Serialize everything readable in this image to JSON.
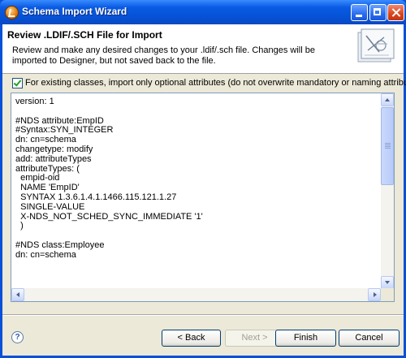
{
  "window": {
    "title": "Schema Import Wizard"
  },
  "header": {
    "title": "Review .LDIF/.SCH File for Import",
    "description": "Review and make any desired changes to your .ldif/.sch file.  Changes will be imported to Designer, but not saved back to the file."
  },
  "options": {
    "optional_attributes_checked": true,
    "optional_attributes_label": "For existing classes, import only optional attributes (do not overwrite mandatory or naming attributes)"
  },
  "content": {
    "lines": [
      "version: 1",
      "",
      "#NDS attribute:EmpID",
      "#Syntax:SYN_INTEGER",
      "dn: cn=schema",
      "changetype: modify",
      "add: attributeTypes",
      "attributeTypes: (",
      "  empid-oid",
      "  NAME 'EmpID'",
      "  SYNTAX 1.3.6.1.4.1.1466.115.121.1.27",
      "  SINGLE-VALUE",
      "  X-NDS_NOT_SCHED_SYNC_IMMEDIATE '1'",
      "  )",
      "",
      "#NDS class:Employee",
      "dn: cn=schema"
    ]
  },
  "buttons": {
    "back": "< Back",
    "next": "Next >",
    "finish": "Finish",
    "cancel": "Cancel"
  },
  "help": {
    "glyph": "?"
  },
  "icons": {
    "app": "eclipse-icon",
    "banner": "schema-wizard-icon",
    "help": "help-icon"
  }
}
